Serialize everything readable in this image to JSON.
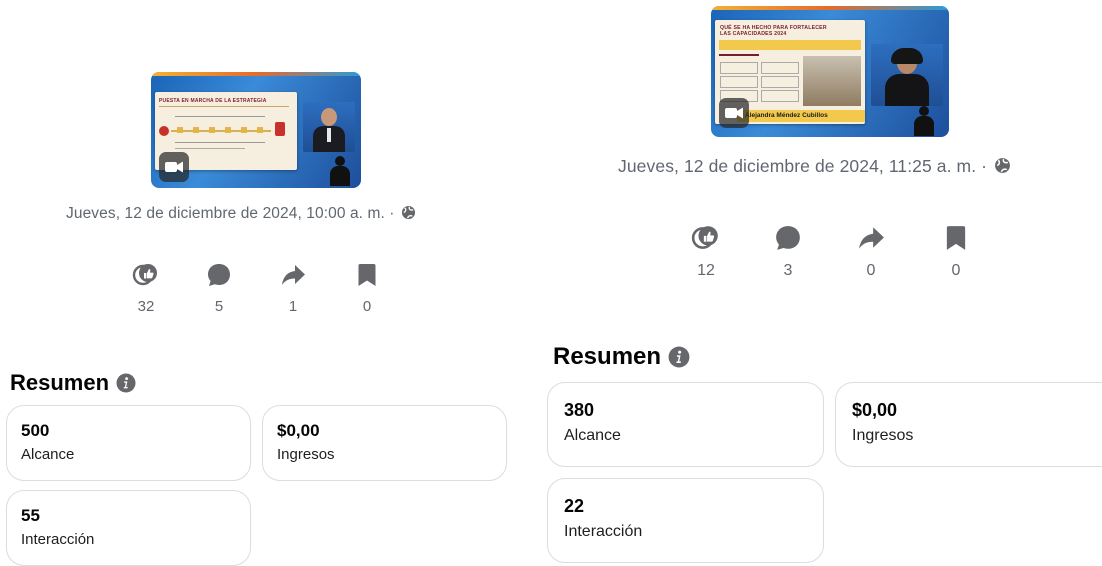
{
  "left": {
    "thumbnail": {
      "slide_title": "PUESTA EN MARCHA DE LA ESTRATEGIA",
      "badge_icon": "video-camera-icon"
    },
    "date": "Jueves, 12 de diciembre de 2024, 10:00 a. m. ·",
    "privacy_icon": "globe-icon",
    "metrics": [
      {
        "icon": "reactions-icon",
        "value": "32"
      },
      {
        "icon": "comment-icon",
        "value": "5"
      },
      {
        "icon": "share-icon",
        "value": "1"
      },
      {
        "icon": "bookmark-icon",
        "value": "0"
      }
    ],
    "summary_title": "Resumen",
    "cards": {
      "reach": {
        "value": "500",
        "label": "Alcance"
      },
      "revenue": {
        "value": "$0,00",
        "label": "Ingresos"
      },
      "interaction": {
        "value": "55",
        "label": "Interacción"
      }
    }
  },
  "right": {
    "thumbnail": {
      "slide_title": "QUÉ SE HA HECHO PARA FORTALECER LAS CAPACIDADES 2024",
      "caption": "Alejandra Méndez Cubillos",
      "badge_icon": "video-camera-icon"
    },
    "date": "Jueves, 12 de diciembre de 2024, 11:25 a. m. ·",
    "privacy_icon": "globe-icon",
    "metrics": [
      {
        "icon": "reactions-icon",
        "value": "12"
      },
      {
        "icon": "comment-icon",
        "value": "3"
      },
      {
        "icon": "share-icon",
        "value": "0"
      },
      {
        "icon": "bookmark-icon",
        "value": "0"
      }
    ],
    "summary_title": "Resumen",
    "cards": {
      "reach": {
        "value": "380",
        "label": "Alcance"
      },
      "revenue": {
        "value": "$0,00",
        "label": "Ingresos"
      },
      "interaction": {
        "value": "22",
        "label": "Interacción"
      }
    }
  },
  "colors": {
    "icon_gray": "#65676b",
    "text_secondary": "#606770",
    "card_border": "#dadde1",
    "accent_red": "#7a1d2a"
  }
}
